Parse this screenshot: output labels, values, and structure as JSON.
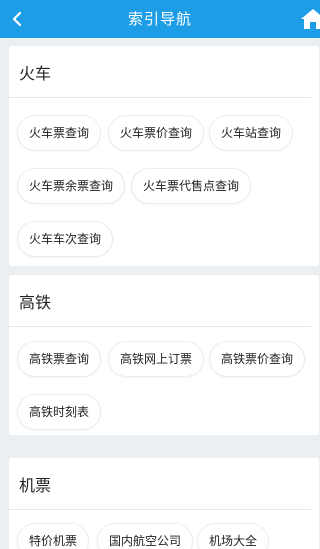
{
  "header": {
    "title": "索引导航",
    "back_icon": "chevron-left-icon",
    "home_icon": "home-icon",
    "bar_color": "#1d9de6"
  },
  "sections": [
    {
      "title": "火车",
      "items": [
        "火车票查询",
        "火车票价查询",
        "火车站查询",
        "火车票余票查询",
        "火车票代售点查询",
        "火车车次查询"
      ]
    },
    {
      "title": "高铁",
      "items": [
        "高铁票查询",
        "高铁网上订票",
        "高铁票价查询",
        "高铁时刻表"
      ]
    },
    {
      "title": "机票",
      "items": [
        "特价机票",
        "国内航空公司",
        "机场大全"
      ]
    }
  ]
}
